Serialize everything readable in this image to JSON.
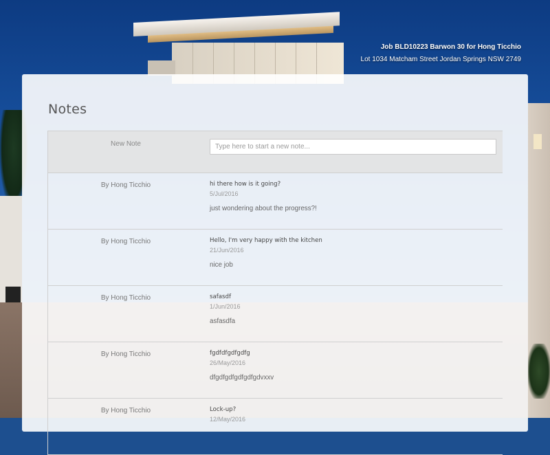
{
  "header": {
    "job_title": "Job BLD10223 Barwon 30 for Hong Ticchio",
    "address": "Lot 1034 Matcham Street Jordan Springs NSW 2749"
  },
  "notes_panel": {
    "title": "Notes",
    "new_note": {
      "label": "New Note",
      "placeholder": "Type here to start a new note...",
      "value": ""
    },
    "notes": [
      {
        "author": "By Hong Ticchio",
        "title": "hi there how is it going?",
        "date": "5/Jul/2016",
        "body": "just wondering about the progress?!"
      },
      {
        "author": "By Hong Ticchio",
        "title": "Hello, I'm very happy with the kitchen",
        "date": "21/Jun/2016",
        "body": "nice job"
      },
      {
        "author": "By Hong Ticchio",
        "title": "safasdf",
        "date": "1/Jun/2016",
        "body": "asfasdfa"
      },
      {
        "author": "By Hong Ticchio",
        "title": "fgdfdfgdfgdfg",
        "date": "26/May/2016",
        "body": "dfgdfgdfgdfgdfgdvxxv"
      },
      {
        "author": "By Hong Ticchio",
        "title": "Lock-up?",
        "date": "12/May/2016",
        "body": ""
      }
    ]
  }
}
